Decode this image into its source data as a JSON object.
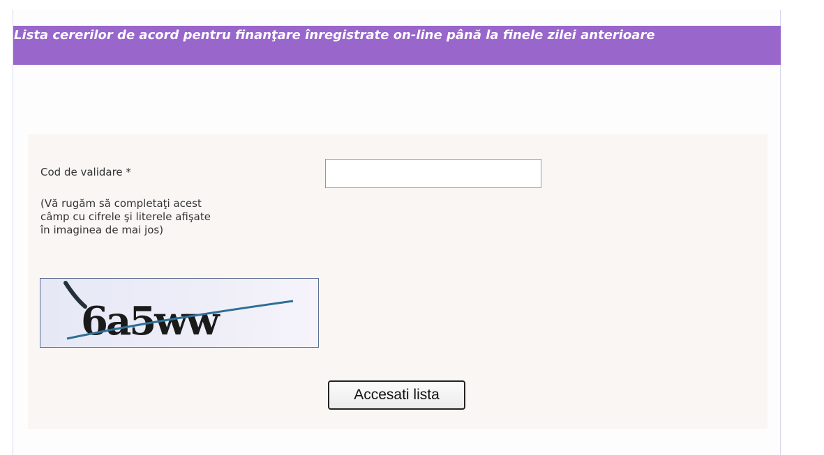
{
  "header": {
    "title": "Lista cererilor de acord pentru finanţare înregistrate on-line până la finele zilei anterioare"
  },
  "form": {
    "label": "Cod de validare *",
    "hint_lines": [
      "(Vă rugăm să completaţi acest",
      "câmp cu cifrele şi literele afişate",
      "în imaginea de mai jos)"
    ],
    "input_value": "",
    "captcha_text": "6a5ww",
    "submit_label": "Accesati lista"
  },
  "colors": {
    "header_background": "#9966cc",
    "panel_background": "#f9f6f4",
    "input_border": "#7f9db9"
  }
}
